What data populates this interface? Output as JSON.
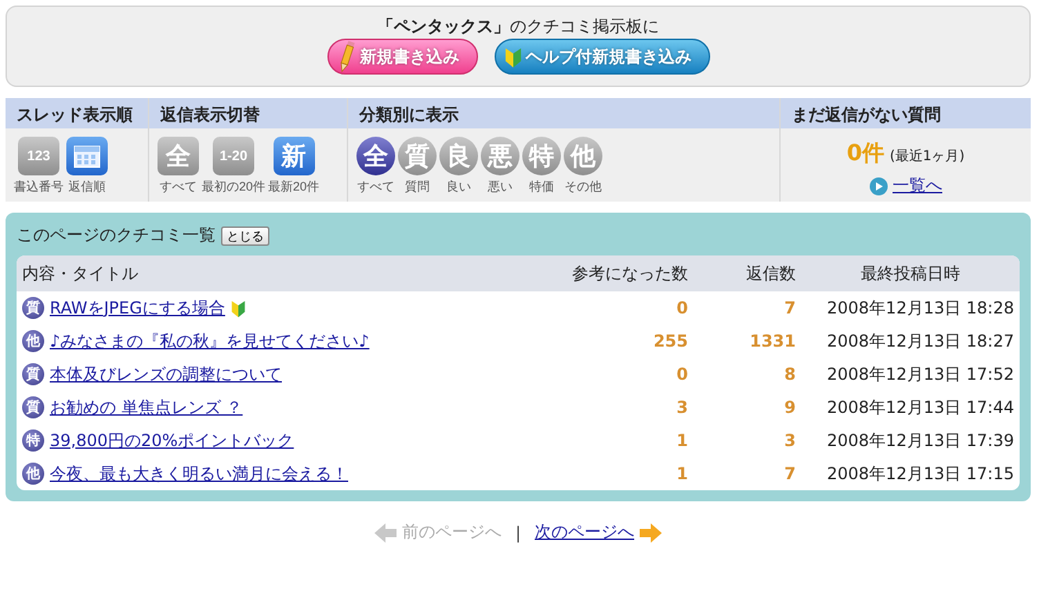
{
  "header": {
    "title": "**「ペンタックス」**のクチコミ掲示板に",
    "buttons": [
      {
        "kind": "pencil",
        "label": "新規書き込み"
      },
      {
        "kind": "leaf",
        "label": "ヘルプ付新規書き込み"
      }
    ]
  },
  "filters": [
    {
      "heading": "スレッド表示順",
      "kind": "square",
      "items": [
        {
          "kind": "text",
          "icon_text": "123",
          "caption": "書込番号",
          "selected": false
        },
        {
          "kind": "calendar",
          "caption": "返信順",
          "selected": true
        }
      ]
    },
    {
      "heading": "返信表示切替",
      "kind": "square",
      "items": [
        {
          "kind": "text",
          "icon_text": "全",
          "caption": "すべて",
          "selected": false
        },
        {
          "kind": "text",
          "icon_text": "1-20",
          "caption": "最初の20件",
          "selected": false
        },
        {
          "kind": "text",
          "icon_text": "新",
          "caption": "最新20件",
          "selected": true
        }
      ]
    },
    {
      "heading": "分類別に表示",
      "kind": "round",
      "items": [
        {
          "kind": "text",
          "icon_text": "全",
          "caption": "すべて",
          "selected": true
        },
        {
          "kind": "text",
          "icon_text": "質",
          "caption": "質問",
          "selected": false
        },
        {
          "kind": "text",
          "icon_text": "良",
          "caption": "良い",
          "selected": false
        },
        {
          "kind": "text",
          "icon_text": "悪",
          "caption": "悪い",
          "selected": false
        },
        {
          "kind": "text",
          "icon_text": "特",
          "caption": "特価",
          "selected": false
        },
        {
          "kind": "text",
          "icon_text": "他",
          "caption": "その他",
          "selected": false
        }
      ]
    }
  ],
  "unanswered": {
    "heading": "まだ返信がない質問",
    "count": "0件",
    "period": "(最近1ヶ月)",
    "link": "一覧へ"
  },
  "list": {
    "title": "このページのクチコミ一覧",
    "close_button": "とじる",
    "columns": [
      "内容・タイトル",
      "参考になった数",
      "返信数",
      "最終投稿日時"
    ],
    "rows": [
      {
        "category": "質",
        "title": "RAWをJPEGにする場合",
        "beginner": true,
        "helpful": "0",
        "replies": "7",
        "date": "2008年12月13日 18:28"
      },
      {
        "category": "他",
        "title": "♪みなさまの『私の秋』を見せてください♪",
        "beginner": false,
        "helpful": "255",
        "replies": "1331",
        "date": "2008年12月13日 18:27"
      },
      {
        "category": "質",
        "title": "本体及びレンズの調整について",
        "beginner": false,
        "helpful": "0",
        "replies": "8",
        "date": "2008年12月13日 17:52"
      },
      {
        "category": "質",
        "title": "お勧めの 単焦点レンズ ？",
        "beginner": false,
        "helpful": "3",
        "replies": "9",
        "date": "2008年12月13日 17:44"
      },
      {
        "category": "特",
        "title": "39,800円の20%ポイントバック",
        "beginner": false,
        "helpful": "1",
        "replies": "3",
        "date": "2008年12月13日 17:39"
      },
      {
        "category": "他",
        "title": "今夜、最も大きく明るい満月に会える！",
        "beginner": false,
        "helpful": "1",
        "replies": "7",
        "date": "2008年12月13日 17:15"
      }
    ]
  },
  "pager": {
    "prev": {
      "label": "前のページへ",
      "disabled": true
    },
    "separator": "|",
    "next": {
      "label": "次のページへ",
      "disabled": false
    }
  }
}
